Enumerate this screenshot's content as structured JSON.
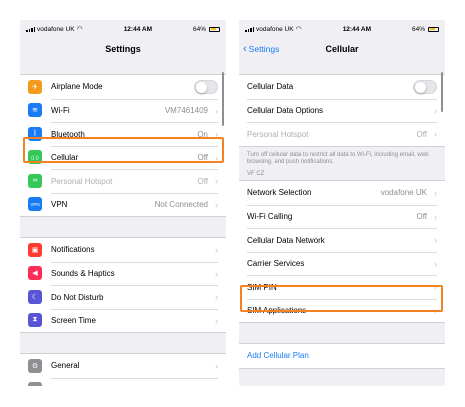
{
  "left_screen": {
    "status": {
      "carrier": "vodafone UK",
      "time": "12:44 AM",
      "battery": "64%",
      "battery_level": 0.64
    },
    "title": "Settings",
    "group1": [
      {
        "id": "airplane",
        "icon": "airplane-icon",
        "glyph": "✈",
        "color": "#f49a1c",
        "label": "Airplane Mode",
        "toggle": false
      },
      {
        "id": "wifi",
        "icon": "wifi-icon",
        "glyph": "≋",
        "color": "#1a7cf5",
        "label": "Wi-Fi",
        "value": "VM7461409"
      },
      {
        "id": "bluetooth",
        "icon": "bluetooth-icon",
        "glyph": "ᛒ",
        "color": "#1a7cf5",
        "label": "Bluetooth",
        "value": "On"
      },
      {
        "id": "cellular",
        "icon": "cellular-antenna-icon",
        "glyph": "((·))",
        "color": "#34c759",
        "label": "Cellular",
        "value": "Off"
      },
      {
        "id": "hotspot",
        "icon": "hotspot-icon",
        "glyph": "∞",
        "color": "#34c759",
        "label": "Personal Hotspot",
        "value": "Off",
        "disabled": true
      },
      {
        "id": "vpn",
        "icon": "vpn-icon",
        "glyph": "VPN",
        "color": "#1a7cf5",
        "label": "VPN",
        "value": "Not Connected"
      }
    ],
    "group2": [
      {
        "id": "notifications",
        "icon": "notifications-icon",
        "glyph": "▣",
        "color": "#ff3b30",
        "label": "Notifications"
      },
      {
        "id": "sounds",
        "icon": "speaker-icon",
        "glyph": "◀",
        "color": "#ff2d55",
        "label": "Sounds & Haptics"
      },
      {
        "id": "dnd",
        "icon": "moon-icon",
        "glyph": "☾",
        "color": "#5856d6",
        "label": "Do Not Disturb"
      },
      {
        "id": "screentime",
        "icon": "hourglass-icon",
        "glyph": "⧗",
        "color": "#5856d6",
        "label": "Screen Time"
      }
    ],
    "group3": [
      {
        "id": "general",
        "icon": "gear-icon",
        "glyph": "⚙",
        "color": "#8e8e93",
        "label": "General"
      },
      {
        "id": "control",
        "icon": "control-center-icon",
        "glyph": "☰",
        "color": "#8e8e93",
        "label": "Control Center"
      }
    ]
  },
  "right_screen": {
    "status": {
      "carrier": "vodafone UK",
      "time": "12:44 AM",
      "battery": "64%",
      "battery_level": 0.64
    },
    "back_label": "Settings",
    "title": "Cellular",
    "group1": [
      {
        "id": "cellular-data",
        "label": "Cellular Data",
        "toggle": false
      },
      {
        "id": "cellular-data-options",
        "label": "Cellular Data Options"
      },
      {
        "id": "personal-hotspot",
        "label": "Personal Hotspot",
        "value": "Off",
        "disabled": true
      }
    ],
    "footnote": "Turn off cellular data to restrict all data to Wi-Fi, including email, web browsing, and push notifications.",
    "section_header": "VF CZ",
    "group2": [
      {
        "id": "network-selection",
        "label": "Network Selection",
        "value": "vodafone UK"
      },
      {
        "id": "wifi-calling",
        "label": "Wi-Fi Calling",
        "value": "Off"
      },
      {
        "id": "cellular-data-network",
        "label": "Cellular Data Network"
      },
      {
        "id": "carrier-services",
        "label": "Carrier Services"
      },
      {
        "id": "sim-pin",
        "label": "SIM PIN"
      },
      {
        "id": "sim-applications",
        "label": "SIM Applications"
      }
    ],
    "add_plan_label": "Add Cellular Plan"
  },
  "colors": {
    "accent": "#1a7cf5",
    "highlight": "#f58220",
    "background": "#efeff4"
  }
}
